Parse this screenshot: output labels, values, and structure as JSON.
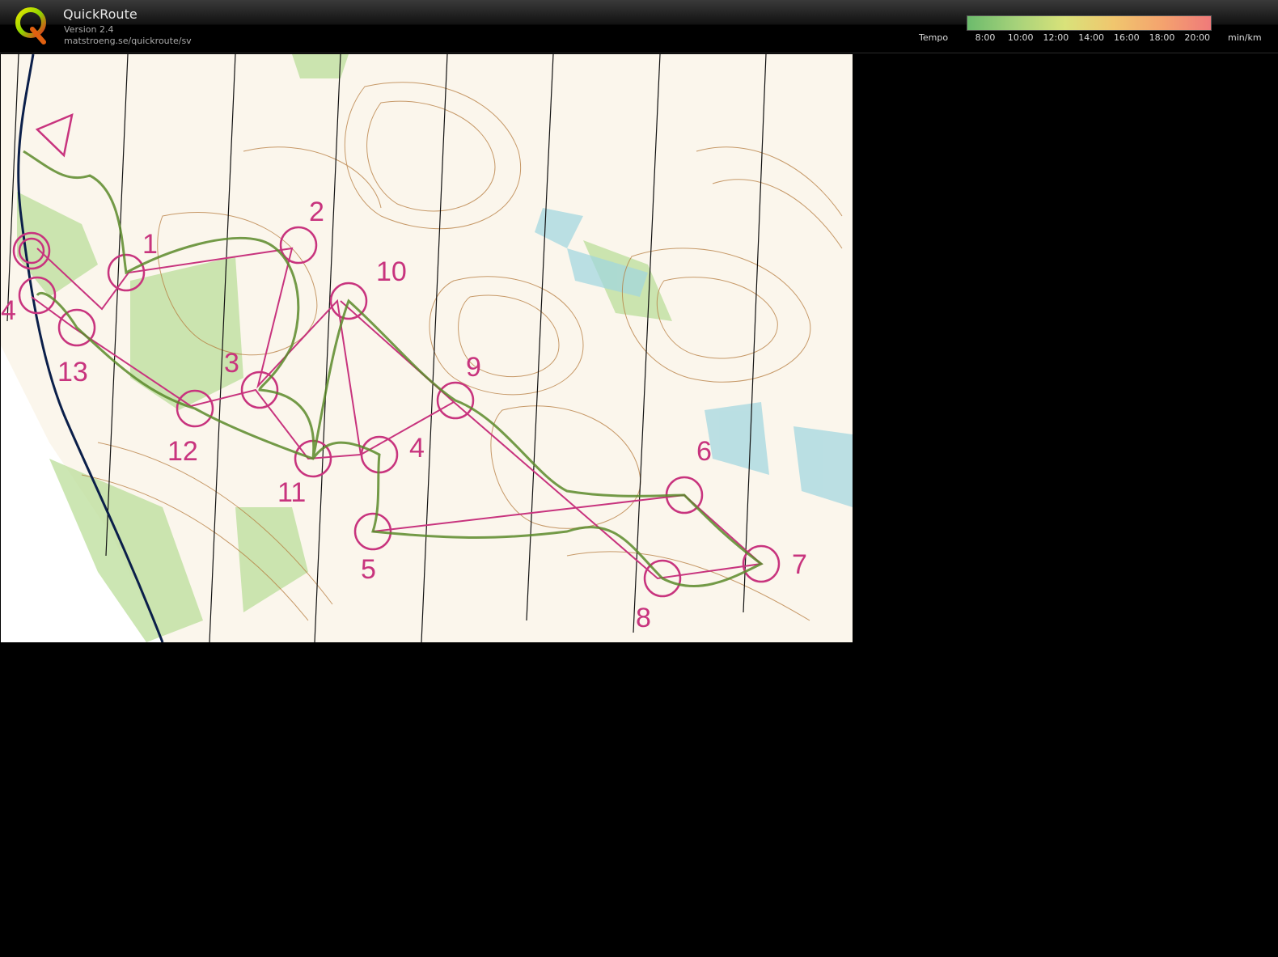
{
  "app": {
    "name": "QuickRoute",
    "version": "Version 2.4",
    "url": "matstroeng.se/quickroute/sv"
  },
  "tempo_legend": {
    "label": "Tempo",
    "ticks": [
      "8:00",
      "10:00",
      "12:00",
      "14:00",
      "16:00",
      "18:00",
      "20:00"
    ],
    "unit": "min/km",
    "gradient_colors": [
      "#6cbb6c",
      "#a6d27a",
      "#d9e27a",
      "#f0c66e",
      "#f4a36e",
      "#ef7a7a"
    ]
  },
  "map": {
    "course_color": "#c8347e",
    "route_color": "#5b8a2a",
    "controls": [
      "1",
      "2",
      "3",
      "4",
      "5",
      "6",
      "7",
      "8",
      "9",
      "10",
      "11",
      "12",
      "13",
      "4"
    ]
  }
}
